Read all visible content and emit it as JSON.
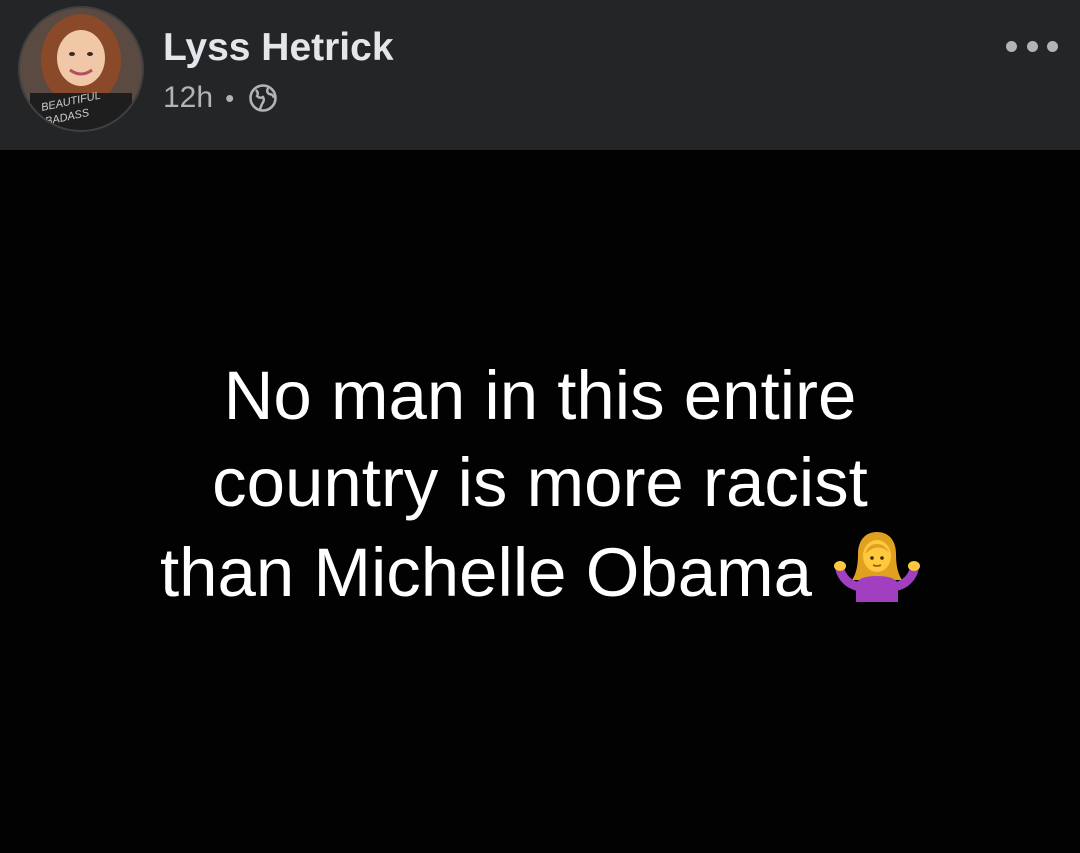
{
  "post": {
    "author_name": "Lyss Hetrick",
    "timestamp": "12h",
    "separator": "•",
    "audience_icon": "globe-icon",
    "more_icon": "more-options-icon",
    "avatar_text": [
      "BEAUTIFUL",
      "BADASS"
    ],
    "image_text": {
      "line1": "No man in this entire",
      "line2": "country is more racist",
      "line3": "than Michelle Obama",
      "emoji": "person-shrugging-emoji"
    }
  },
  "colors": {
    "header_bg": "#242526",
    "name_text": "#e4e6eb",
    "meta_text": "#b0b3b8",
    "image_bg": "#020202",
    "image_text": "#ffffff"
  }
}
